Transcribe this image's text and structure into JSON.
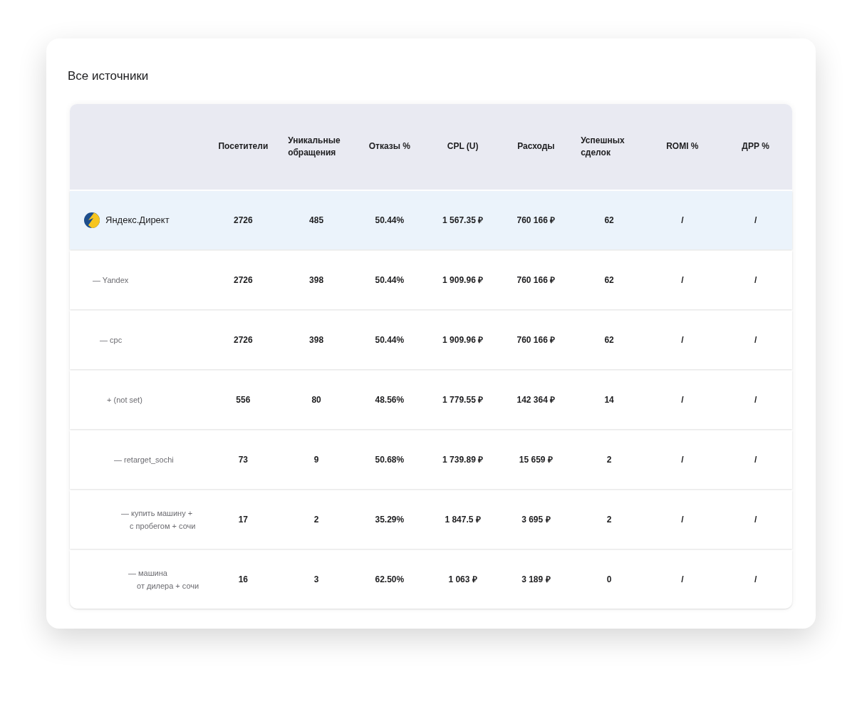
{
  "title": "Все источники",
  "table": {
    "columns": [
      "Посетители",
      "Уникальные обращения",
      "Отказы %",
      "CPL (U)",
      "Расходы",
      "Успешных сделок",
      "ROMI  %",
      "ДРР %"
    ],
    "rows": [
      {
        "label": "Яндекс.Директ",
        "kind": "source",
        "selected": true,
        "cells": [
          "2726",
          "485",
          "50.44%",
          "1 567.35 ₽",
          "760 166 ₽",
          "62",
          "/",
          "/"
        ],
        "children": [
          {
            "label": "— Yandex",
            "selected": false,
            "cells": [
              "2726",
              "398",
              "50.44%",
              "1 909.96 ₽",
              "760 166 ₽",
              "62",
              "/",
              "/"
            ],
            "children": [
              {
                "label": "— cpc",
                "selected": false,
                "cells": [
                  "2726",
                  "398",
                  "50.44%",
                  "1 909.96 ₽",
                  "760 166 ₽",
                  "62",
                  "/",
                  "/"
                ],
                "children": [
                  {
                    "label": "+ (not set)",
                    "selected": false,
                    "cells": [
                      "556",
                      "80",
                      "48.56%",
                      "1 779.55 ₽",
                      "142 364 ₽",
                      "14",
                      "/",
                      "/"
                    ],
                    "children": [
                      {
                        "label": "— retarget_sochi",
                        "selected": false,
                        "cells": [
                          "73",
                          "9",
                          "50.68%",
                          "1 739.89 ₽",
                          "15 659 ₽",
                          "2",
                          "/",
                          "/"
                        ],
                        "children": [
                          {
                            "label": "— купить машину +\nс пробегом + сочи",
                            "selected": false,
                            "cells": [
                              "17",
                              "2",
                              "35.29%",
                              "1 847.5 ₽",
                              "3 695 ₽",
                              "2",
                              "/",
                              "/"
                            ],
                            "children": [
                              {
                                "label": "— машина\nот дилера + сочи",
                                "selected": false,
                                "cells": [
                                  "16",
                                  "3",
                                  "62.50%",
                                  "1 063 ₽",
                                  "3 189 ₽",
                                  "0",
                                  "/",
                                  "/"
                                ]
                              }
                            ]
                          }
                        ]
                      }
                    ]
                  }
                ]
              }
            ]
          }
        ]
      }
    ]
  }
}
